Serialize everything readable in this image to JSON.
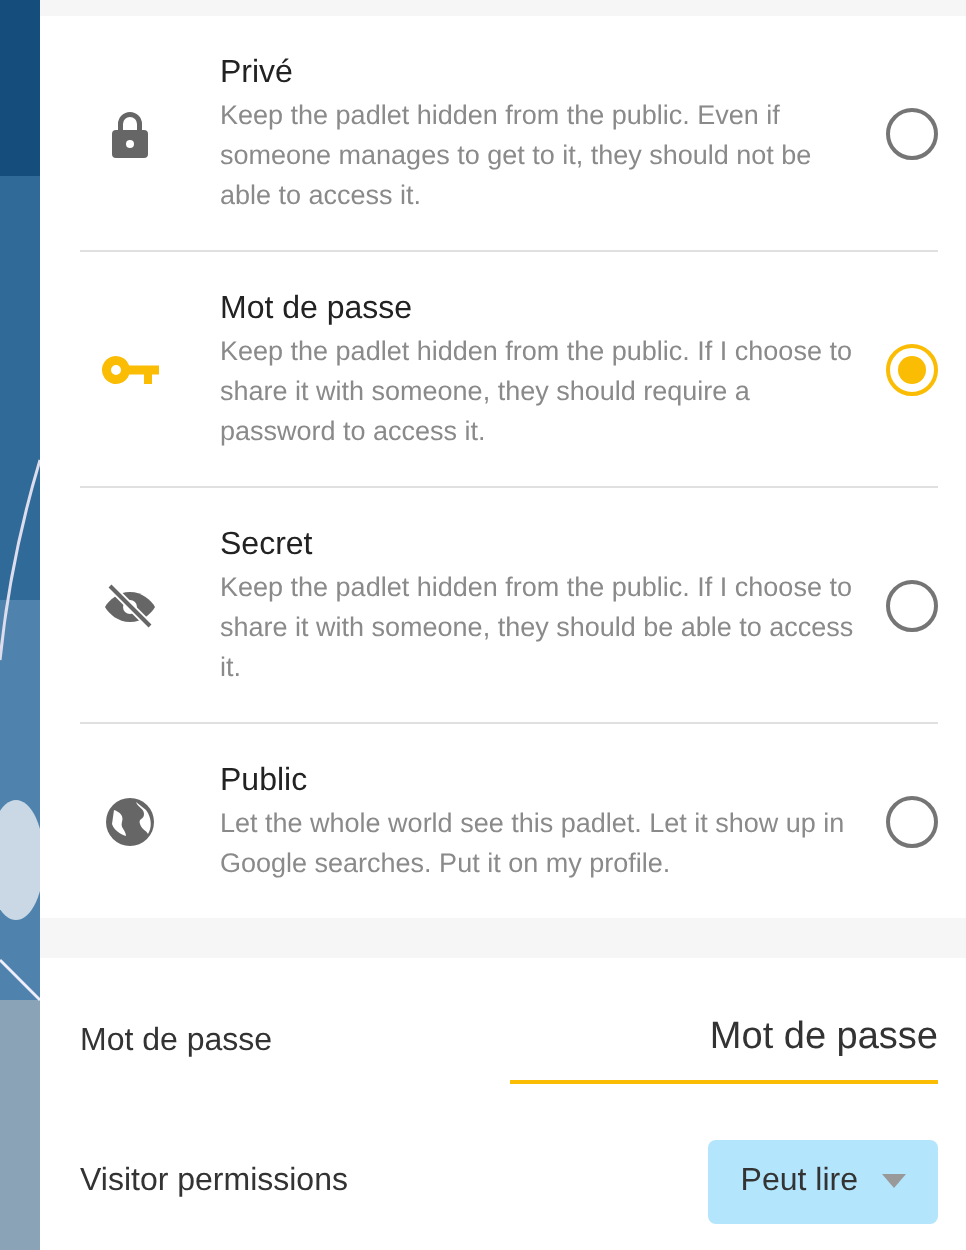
{
  "privacy_options": [
    {
      "title": "Privé",
      "description": "Keep the padlet hidden from the public. Even if someone manages to get to it, they should not be able to access it.",
      "selected": false
    },
    {
      "title": "Mot de passe",
      "description": "Keep the padlet hidden from the public. If I choose to share it with someone, they should require a password to access it.",
      "selected": true
    },
    {
      "title": "Secret",
      "description": "Keep the padlet hidden from the public. If I choose to share it with someone, they should be able to access it.",
      "selected": false
    },
    {
      "title": "Public",
      "description": "Let the whole world see this padlet. Let it show up in Google searches. Put it on my profile.",
      "selected": false
    }
  ],
  "password": {
    "label": "Mot de passe",
    "value": "Mot de passe"
  },
  "visitor_permissions": {
    "label": "Visitor permissions",
    "value": "Peut lire"
  }
}
